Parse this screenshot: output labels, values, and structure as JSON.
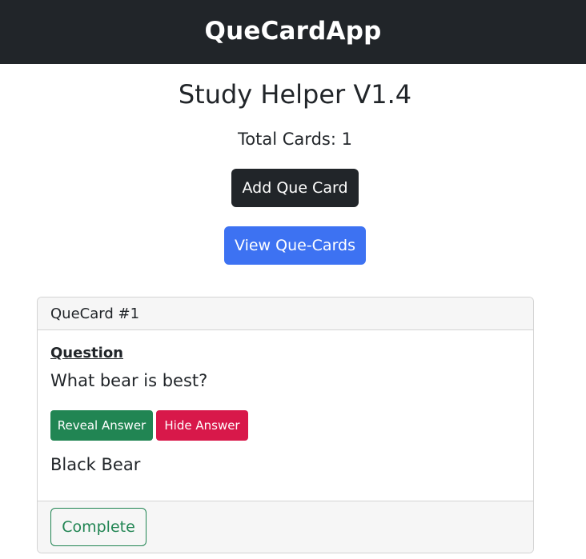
{
  "navbar": {
    "brand": "QueCardApp"
  },
  "main": {
    "title": "Study Helper V1.4",
    "total_cards": "Total Cards: 1",
    "add_button_label": "Add Que Card",
    "view_button_label": "View Que-Cards"
  },
  "card": {
    "header": "QueCard #1",
    "question_label": "Question",
    "question": "What bear is best?",
    "reveal_label": "Reveal Answer",
    "hide_label": "Hide Answer",
    "answer": "Black Bear",
    "complete_label": "Complete"
  },
  "colors": {
    "navbar_bg": "#212529",
    "primary": "#3d72f2",
    "success": "#218553",
    "danger": "#d8184a"
  }
}
